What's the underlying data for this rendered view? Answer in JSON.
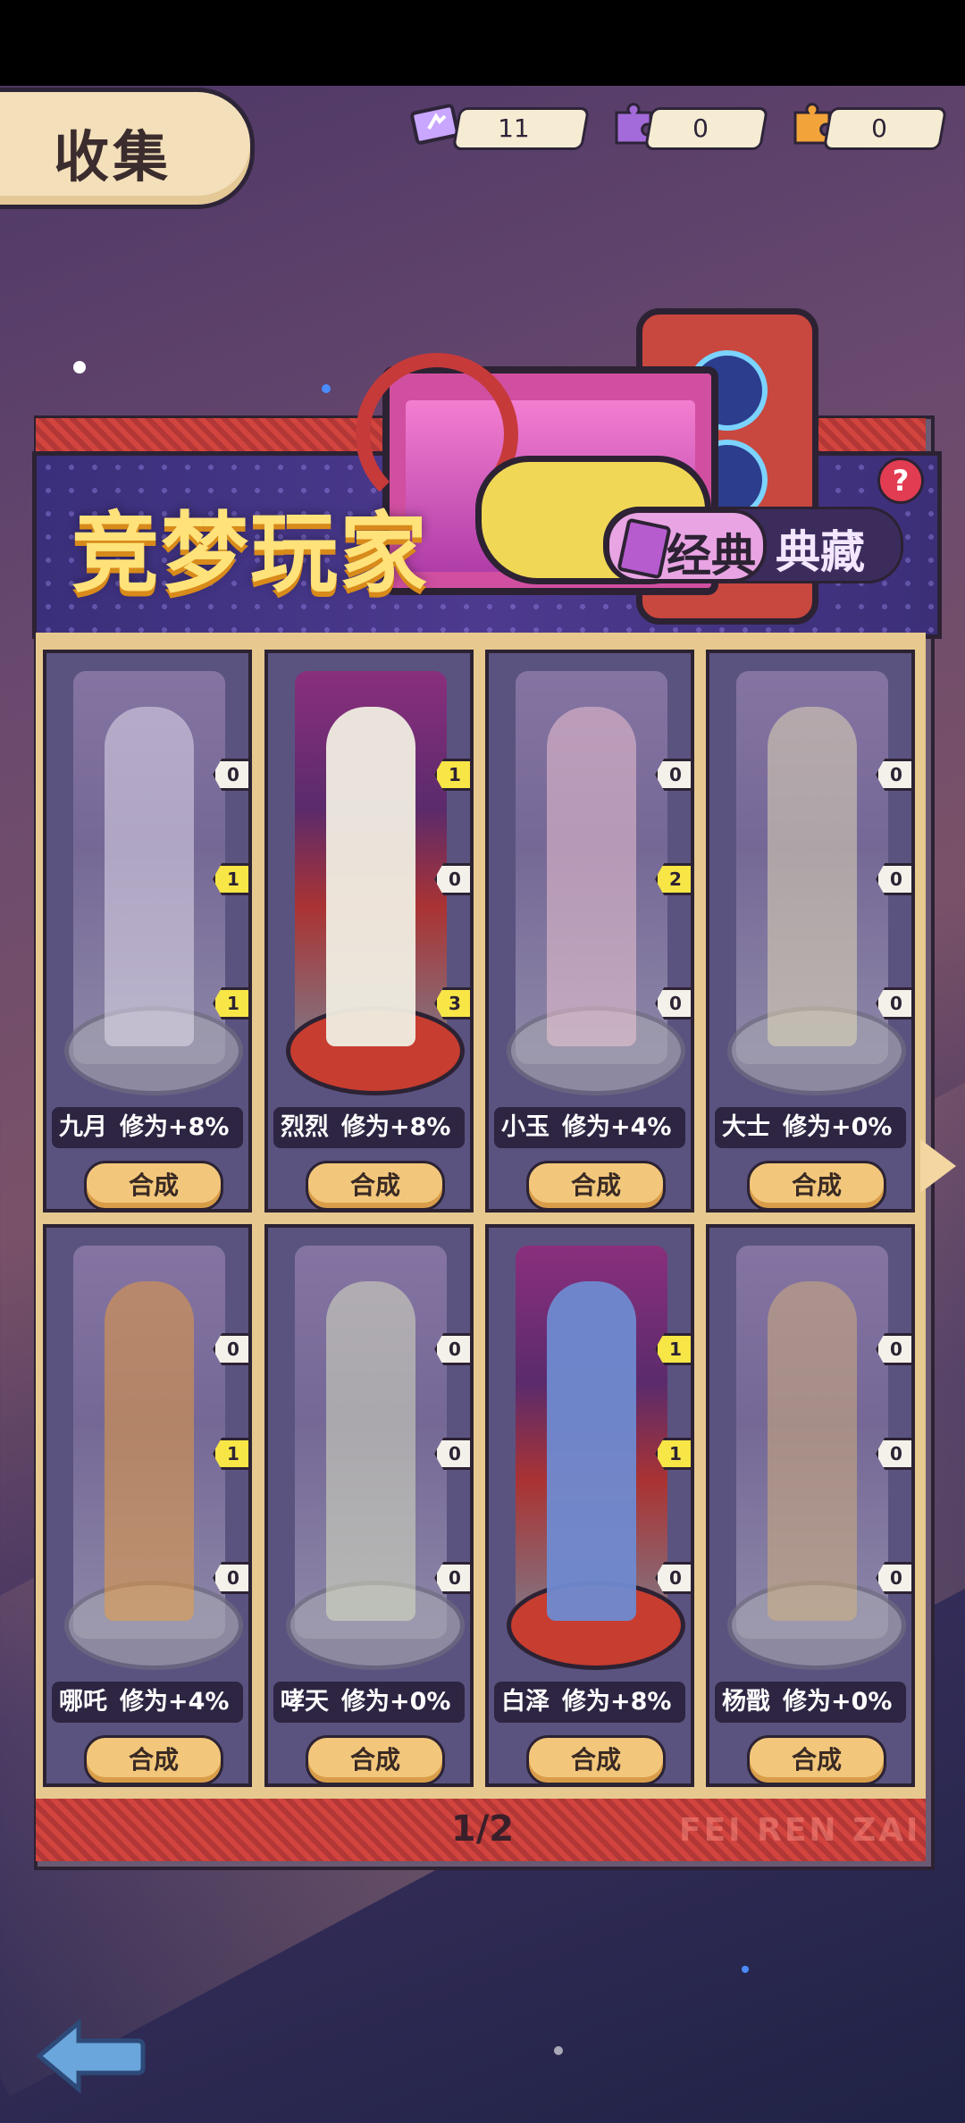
{
  "header": {
    "title": "收集"
  },
  "resources": [
    {
      "icon": "ticket-icon",
      "value": "11"
    },
    {
      "icon": "purple-puzzle-icon",
      "value": "0"
    },
    {
      "icon": "orange-puzzle-icon",
      "value": "0"
    }
  ],
  "banner": {
    "title": "竞梦玩家",
    "tab_classic": "经典",
    "tab_collection": "典藏",
    "help": "?"
  },
  "cards": [
    {
      "name": "九月",
      "bonus": "修为+8%",
      "button": "合成",
      "badges": [
        "0",
        "1",
        "1"
      ],
      "owned": false
    },
    {
      "name": "烈烈",
      "bonus": "修为+8%",
      "button": "合成",
      "badges": [
        "1",
        "0",
        "3"
      ],
      "owned": true
    },
    {
      "name": "小玉",
      "bonus": "修为+4%",
      "button": "合成",
      "badges": [
        "0",
        "2",
        "0"
      ],
      "owned": false
    },
    {
      "name": "大士",
      "bonus": "修为+0%",
      "button": "合成",
      "badges": [
        "0",
        "0",
        "0"
      ],
      "owned": false
    },
    {
      "name": "哪吒",
      "bonus": "修为+4%",
      "button": "合成",
      "badges": [
        "0",
        "1",
        "0"
      ],
      "owned": false
    },
    {
      "name": "哮天",
      "bonus": "修为+0%",
      "button": "合成",
      "badges": [
        "0",
        "0",
        "0"
      ],
      "owned": false
    },
    {
      "name": "白泽",
      "bonus": "修为+8%",
      "button": "合成",
      "badges": [
        "1",
        "1",
        "0"
      ],
      "owned": true
    },
    {
      "name": "杨戬",
      "bonus": "修为+0%",
      "button": "合成",
      "badges": [
        "0",
        "0",
        "0"
      ],
      "owned": false
    }
  ],
  "pagination": {
    "current": "1/2"
  },
  "watermark": "FEI REN ZAI",
  "colors": {
    "accent": "#ffe27a",
    "button": "#f3c77b",
    "badge_highlight": "#f8e646"
  }
}
